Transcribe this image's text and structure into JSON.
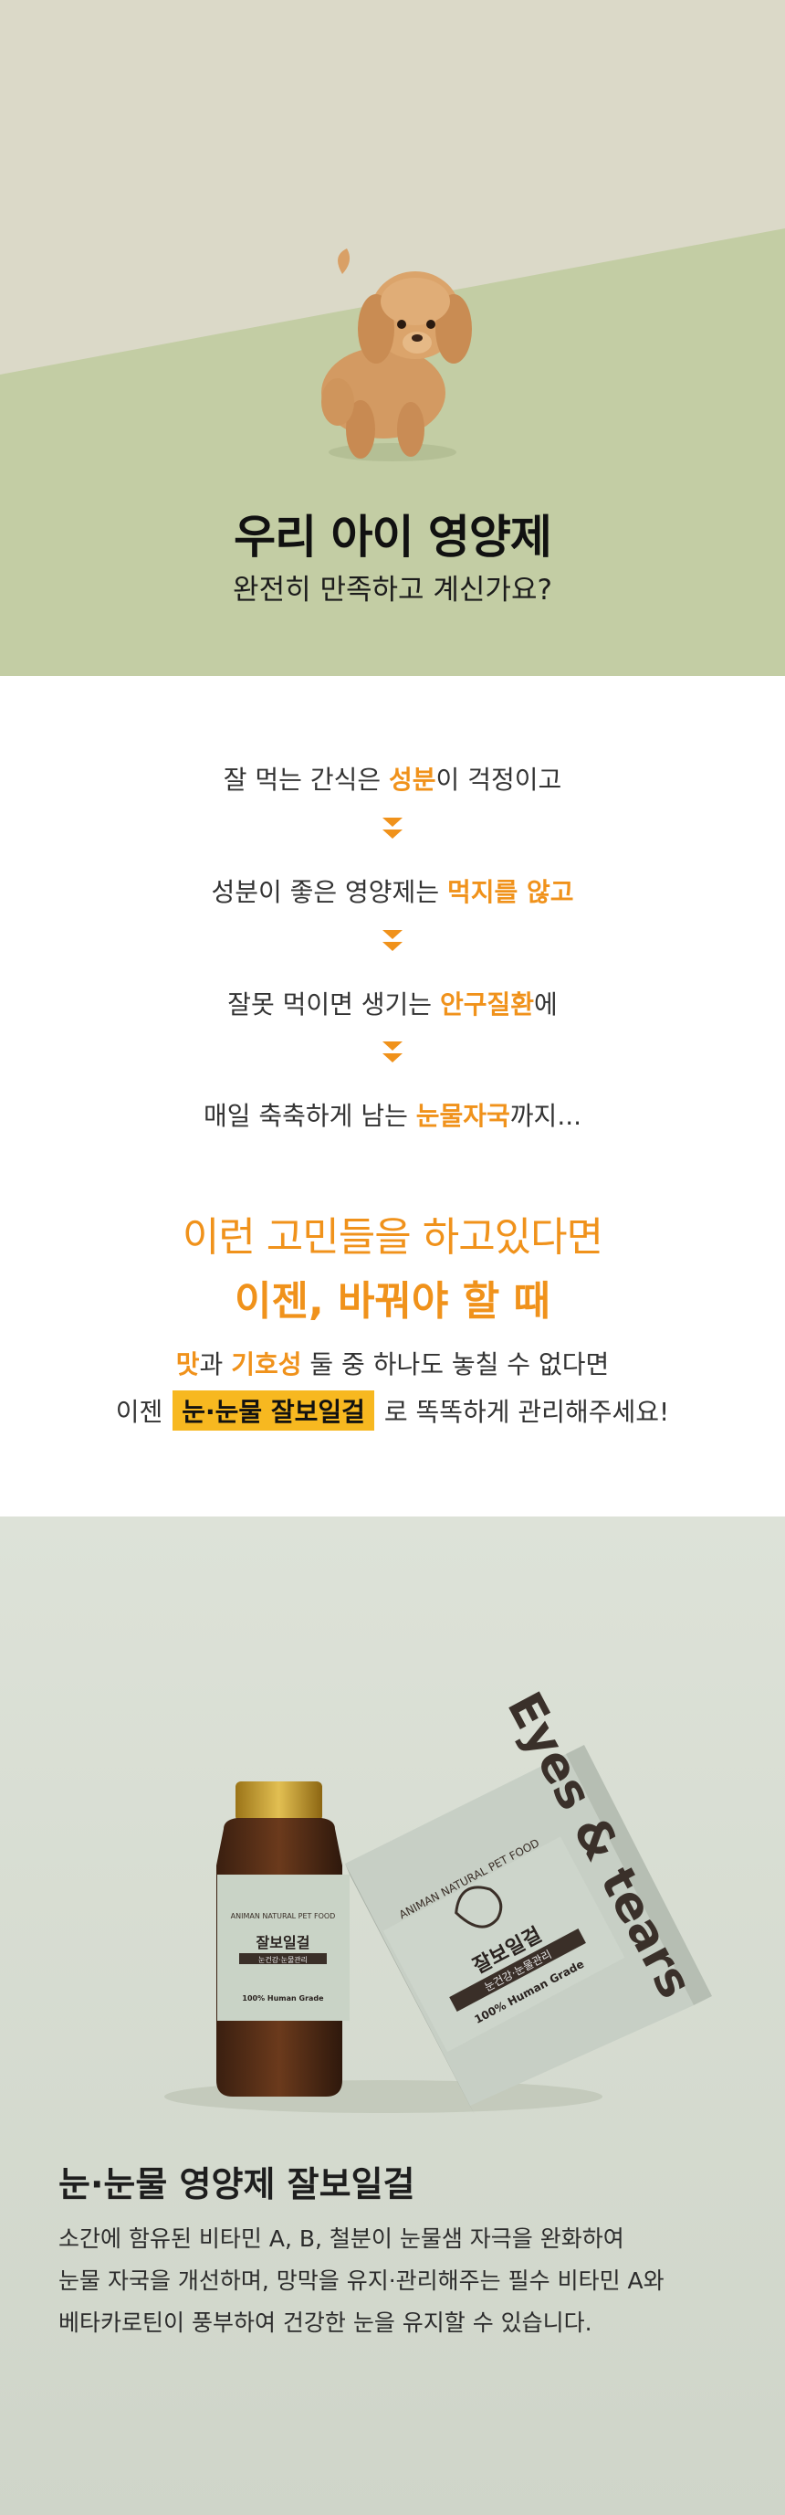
{
  "hero": {
    "title": "우리 아이 영양제",
    "subtitle": "완전히 만족하고 계신가요?"
  },
  "concerns": {
    "lines": [
      {
        "before": "잘 먹는 간식은 ",
        "highlight": "성분",
        "after": "이 걱정이고"
      },
      {
        "before": "성분이 좋은 영양제는 ",
        "highlight": "먹지를 않고",
        "after": ""
      },
      {
        "before": "잘못 먹이면 생기는 ",
        "highlight": "안구질환",
        "after": "에"
      },
      {
        "before": "매일 축축하게 남는 ",
        "highlight": "눈물자국",
        "after": "까지..."
      }
    ],
    "headline_light": "이런 고민들을 하고있다면",
    "headline_bold": "이젠, 바꿔야 할 때",
    "note_line1": {
      "hl1": "맛",
      "mid1": "과 ",
      "hl2": "기호성",
      "rest": " 둘 중 하나도 놓칠 수 없다면"
    },
    "note_line2": {
      "before": "이젠 ",
      "badge": "눈·눈물 잘보일걸",
      "after": " 로 똑똑하게 관리해주세요!"
    },
    "accent_color": "#f0921b",
    "badge_color": "#f7b820"
  },
  "product": {
    "box_side_text": "Eyes & tears",
    "box_brand": "ANIMAN NATURAL PET FOOD",
    "box_name": "잘보일걸",
    "box_tag": "눈건강·눈물관리",
    "box_grade": "100% Human Grade",
    "bottle_brand": "ANIMAN NATURAL PET FOOD",
    "bottle_name": "잘보일걸",
    "bottle_tag": "눈건강·눈물관리",
    "bottle_grade": "100% Human Grade",
    "title": "눈·눈물 영양제 잘보일걸",
    "desc": [
      "소간에 함유된 비타민 A, B, 철분이 눈물샘 자극을 완화하여",
      "눈물 자국을 개선하며, 망막을 유지·관리해주는 필수 비타민 A와",
      "베타카로틴이 풍부하여 건강한 눈을 유지할 수 있습니다."
    ]
  }
}
